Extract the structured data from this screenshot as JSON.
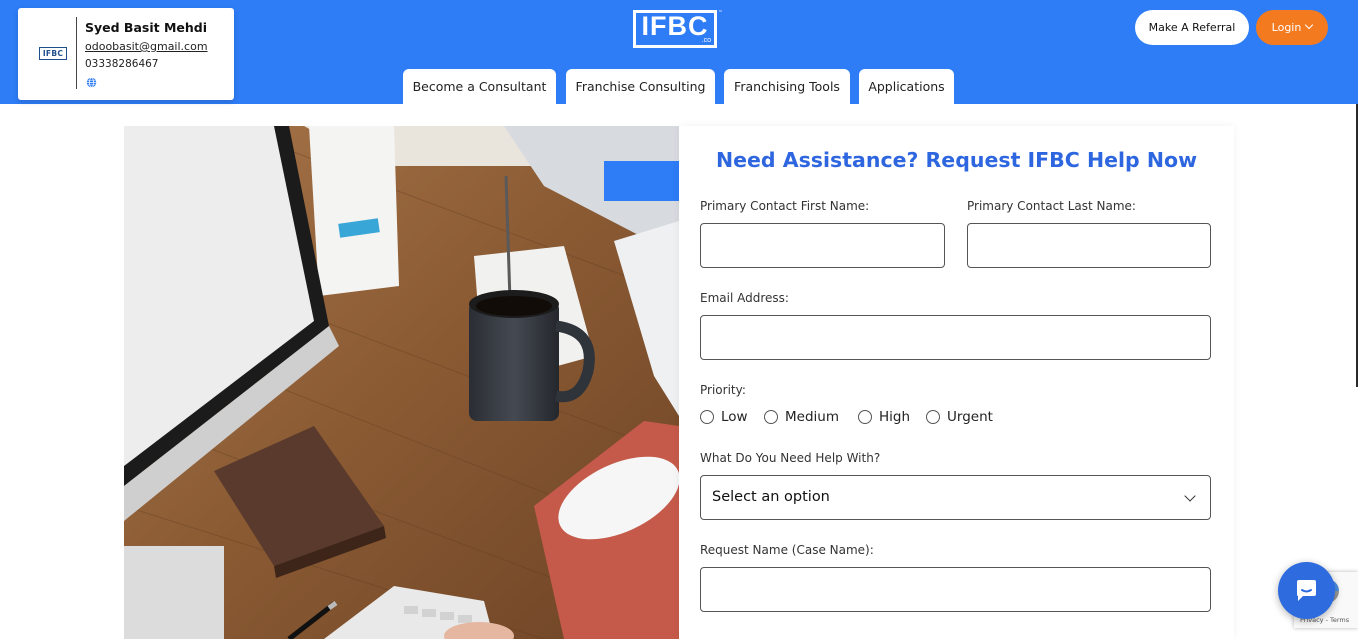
{
  "profile": {
    "logo_text": "IFBC",
    "name": "Syed Basit Mehdi",
    "email": "odoobasit@gmail.com",
    "phone": "03338286467",
    "globe_icon": "globe-icon"
  },
  "brand": {
    "logo_text": "IFBC",
    "logo_sub": ".co",
    "tm": "™"
  },
  "nav": {
    "tabs": [
      {
        "label": "Become a Consultant"
      },
      {
        "label": "Franchise Consulting"
      },
      {
        "label": "Franchising Tools"
      },
      {
        "label": "Applications"
      }
    ]
  },
  "header_actions": {
    "referral_label": "Make A Referral",
    "login_label": "Login"
  },
  "form": {
    "title": "Need Assistance? Request IFBC Help Now",
    "first_name_label": "Primary Contact First Name:",
    "first_name_value": "",
    "last_name_label": "Primary Contact Last Name:",
    "last_name_value": "",
    "email_label": "Email Address:",
    "email_value": "",
    "priority_label": "Priority:",
    "priority_options": [
      "Low",
      "Medium",
      "High",
      "Urgent"
    ],
    "help_label": "What Do You Need Help With?",
    "help_selected": "Select an option",
    "request_name_label": "Request Name (Case Name):",
    "request_name_value": ""
  },
  "recaptcha": {
    "links": "Privacy - Terms"
  },
  "colors": {
    "header_blue": "#2e7cf6",
    "login_orange": "#f47a20",
    "title_blue": "#2e66e0",
    "chat_blue": "#2e6bdf"
  }
}
